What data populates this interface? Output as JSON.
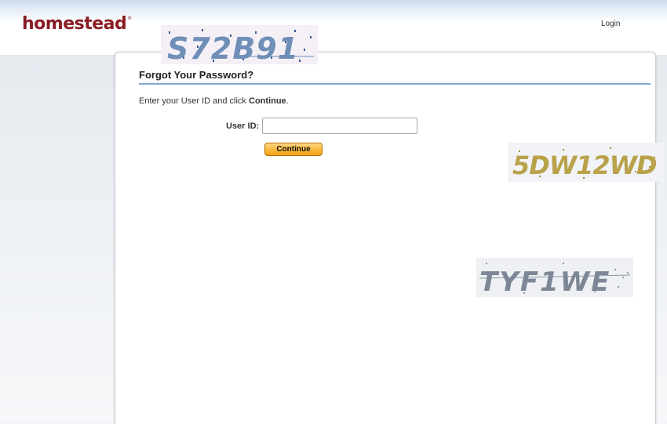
{
  "header": {
    "logo_text": "homestead",
    "logo_mark": "®",
    "login_label": "Login"
  },
  "form": {
    "title": "Forgot Your Password?",
    "instruction_prefix": "Enter your User ID and click ",
    "instruction_emphasis": "Continue",
    "instruction_suffix": ".",
    "userid_label": "User ID:",
    "userid_value": "",
    "continue_label": "Continue"
  },
  "captchas": [
    {
      "text": "S72B91",
      "color": "#6f8fb8",
      "background": "#f4f0f6"
    },
    {
      "text": "5DW12WD",
      "color": "#b9a24a",
      "background": "#f1f3f7"
    },
    {
      "text": "TYF1WE",
      "color": "#7d8796",
      "background": "#eef0f4"
    }
  ]
}
